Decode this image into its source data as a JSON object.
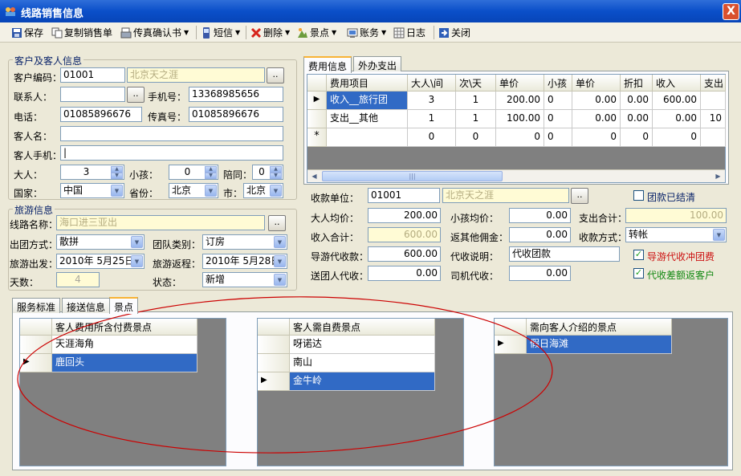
{
  "window": {
    "title": "线路销售信息",
    "close_label": "X"
  },
  "toolbar": [
    {
      "label": "保存",
      "icon": "save-icon"
    },
    {
      "label": "复制销售单",
      "icon": "copy-icon"
    },
    {
      "label": "传真确认书",
      "icon": "fax-icon",
      "dropdown": true
    },
    {
      "label": "短信",
      "icon": "sms-icon",
      "dropdown": true
    },
    {
      "label": "删除",
      "icon": "delete-icon",
      "dropdown": true
    },
    {
      "label": "景点",
      "icon": "scenic-icon",
      "dropdown": true
    },
    {
      "label": "账务",
      "icon": "accounts-icon",
      "dropdown": true
    },
    {
      "label": "日志",
      "icon": "log-icon"
    },
    {
      "label": "关闭",
      "icon": "close-icon"
    }
  ],
  "customer": {
    "group_title": "客户及客人信息",
    "code_label": "客户编码：",
    "code_value": "01001",
    "code_name": "北京天之涯",
    "contact_label": "联系人：",
    "contact_value": "",
    "mobile_label": "手机号：",
    "mobile_value": "13368985656",
    "phone_label": "电话：",
    "phone_value": "01085896676",
    "fax_label": "传真号：",
    "fax_value": "01085896676",
    "guest_name_label": "客人名：",
    "guest_name_value": "",
    "guest_mobile_label": "客人手机：",
    "guest_mobile_value": "|",
    "adult_label": "大人：",
    "adult_value": "3",
    "child_label": "小孩：",
    "child_value": "0",
    "companion_label": "陪同：",
    "companion_value": "0",
    "country_label": "国家：",
    "country_value": "中国",
    "province_label": "省份：",
    "province_value": "北京",
    "city_label": "市：",
    "city_value": "北京"
  },
  "tour": {
    "group_title": "旅游信息",
    "route_label": "线路名称：",
    "route_value": "海口进三亚出",
    "depart_type_label": "出团方式：",
    "depart_type_value": "散拼",
    "team_type_label": "团队类别：",
    "team_type_value": "订房",
    "start_label": "旅游出发：",
    "start_value": "2010年 5月25日",
    "return_label": "旅游返程：",
    "return_value": "2010年 5月28日",
    "days_label": "天数：",
    "days_value": "4",
    "status_label": "状态：",
    "status_value": "新增"
  },
  "fee_tabs": [
    {
      "label": "费用信息",
      "active": true
    },
    {
      "label": "外办支出",
      "active": false
    }
  ],
  "fee_grid": {
    "headers": [
      "费用项目",
      "大人\\间",
      "次\\天",
      "单价",
      "小孩",
      "单价",
      "折扣",
      "收入",
      "支出"
    ],
    "rows": [
      [
        "收入__旅行团",
        "3",
        "1",
        "200.00",
        "0",
        "0.00",
        "0.00",
        "600.00",
        ""
      ],
      [
        "支出__其他",
        "1",
        "1",
        "100.00",
        "0",
        "0.00",
        "0.00",
        "0.00",
        "10"
      ],
      [
        "",
        "0",
        "0",
        "0",
        "0",
        "0",
        "0",
        "0",
        ""
      ]
    ],
    "new_row_marker": "*",
    "scroll_grip": "|||"
  },
  "payment": {
    "unit_label": "收款单位：",
    "unit_code": "01001",
    "unit_name": "北京天之涯",
    "settled_label": "团款已结清",
    "settled_checked": false,
    "adult_avg_label": "大人均价：",
    "adult_avg_value": "200.00",
    "child_avg_label": "小孩均价：",
    "child_avg_value": "0.00",
    "expense_total_label": "支出合计：",
    "expense_total_value": "100.00",
    "income_total_label": "收入合计：",
    "income_total_value": "600.00",
    "rebate_label": "返其他佣金：",
    "rebate_value": "0.00",
    "pay_method_label": "收款方式：",
    "pay_method_value": "转帐",
    "guide_collect_label": "导游代收款：",
    "guide_collect_value": "600.00",
    "collect_note_label": "代收说明：",
    "collect_note_value": "代收团款",
    "guide_offset_label": "导游代收冲团费",
    "guide_offset_checked": true,
    "sender_collect_label": "送团人代收：",
    "sender_collect_value": "0.00",
    "driver_collect_label": "司机代收：",
    "driver_collect_value": "0.00",
    "diff_rebate_label": "代收差额返客户",
    "diff_rebate_checked": true
  },
  "bottom_tabs": [
    {
      "label": "服务标准",
      "active": false
    },
    {
      "label": "接送信息",
      "active": false
    },
    {
      "label": "景点",
      "active": true
    }
  ],
  "scenic": {
    "included": {
      "header": "客人费用所含付费景点",
      "items": [
        "天涯海角",
        "鹿回头"
      ],
      "selected": 1
    },
    "self_paid": {
      "header": "客人需自费景点",
      "items": [
        "呀诺达",
        "南山",
        "金牛岭"
      ],
      "selected": 2
    },
    "recommend": {
      "header": "需向客人介绍的景点",
      "items": [
        "假日海滩"
      ],
      "selected": 0
    }
  },
  "colors": {
    "accent": "#316ac5",
    "title_bar": "#0a4fc9",
    "annotation": "#cc0000",
    "readonly_bg": "#fffbd5"
  }
}
